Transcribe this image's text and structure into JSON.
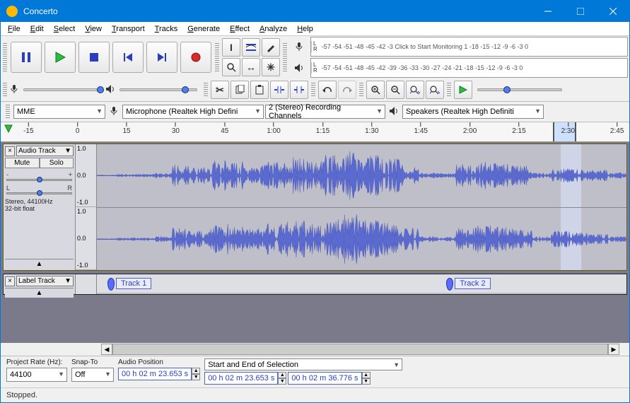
{
  "window": {
    "title": "Concerto"
  },
  "menu": {
    "file": "File",
    "edit": "Edit",
    "select": "Select",
    "view": "View",
    "transport": "Transport",
    "tracks": "Tracks",
    "generate": "Generate",
    "effect": "Effect",
    "analyze": "Analyze",
    "help": "Help"
  },
  "meters": {
    "recLR": {
      "L": "L",
      "R": "R"
    },
    "playLR": {
      "L": "L",
      "R": "R"
    },
    "recScale": "-57 -54 -51 -48 -45 -42 -3",
    "recPrompt": "Click to Start Monitoring",
    "recScale2": "1 -18 -15 -12  -9  -6  -3   0",
    "playScale": "-57 -54 -51 -48 -45 -42 -39 -36 -33 -30 -27 -24 -21 -18 -15 -12  -9  -6  -3   0"
  },
  "devices": {
    "host": "MME",
    "input": "Microphone (Realtek High Defini",
    "channels": "2 (Stereo) Recording Channels",
    "output": "Speakers (Realtek High Definiti"
  },
  "timeline": {
    "ticks": [
      "-15",
      "0",
      "15",
      "30",
      "45",
      "1:00",
      "1:15",
      "1:30",
      "1:45",
      "2:00",
      "2:15",
      "2:30",
      "2:45"
    ]
  },
  "track": {
    "name": "Audio Track",
    "mute": "Mute",
    "solo": "Solo",
    "gainL": "-",
    "gainR": "+",
    "panL": "L",
    "panR": "R",
    "info1": "Stereo, 44100Hz",
    "info2": "32-bit float",
    "scale": {
      "max": "1.0",
      "zero": "0.0",
      "min": "-1.0"
    }
  },
  "labelTrack": {
    "name": "Label Track",
    "labels": [
      {
        "id": "track1",
        "text": "Track 1"
      },
      {
        "id": "track2",
        "text": "Track 2"
      }
    ]
  },
  "status": {
    "projectRateLabel": "Project Rate (Hz):",
    "projectRate": "44100",
    "snapLabel": "Snap-To",
    "snap": "Off",
    "audioPosLabel": "Audio Position",
    "audioPos": "00 h 02 m 23.653 s",
    "selLabel": "Start and End of Selection",
    "selStart": "00 h 02 m 23.653 s",
    "selEnd": "00 h 02 m 36.776 s",
    "stopped": "Stopped."
  }
}
